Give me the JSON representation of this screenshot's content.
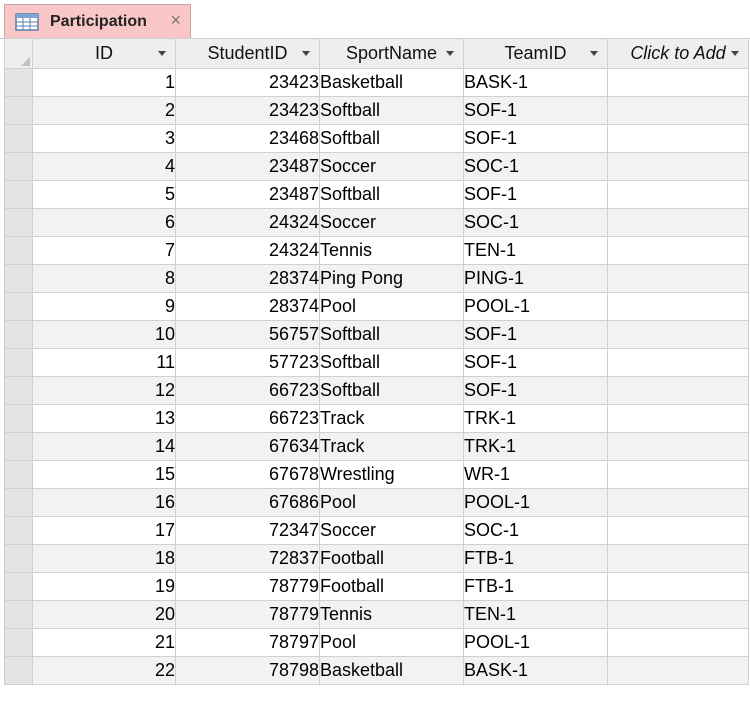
{
  "tab": {
    "label": "Participation",
    "close_symbol": "×",
    "icon": "table-icon"
  },
  "columns": [
    {
      "key": "id",
      "label": "ID"
    },
    {
      "key": "student",
      "label": "StudentID"
    },
    {
      "key": "sport",
      "label": "SportName"
    },
    {
      "key": "team",
      "label": "TeamID"
    },
    {
      "key": "add",
      "label": "Click to Add"
    }
  ],
  "rows": [
    {
      "id": "1",
      "student": "23423",
      "sport": "Basketball",
      "team": "BASK-1"
    },
    {
      "id": "2",
      "student": "23423",
      "sport": "Softball",
      "team": "SOF-1"
    },
    {
      "id": "3",
      "student": "23468",
      "sport": "Softball",
      "team": "SOF-1"
    },
    {
      "id": "4",
      "student": "23487",
      "sport": "Soccer",
      "team": "SOC-1"
    },
    {
      "id": "5",
      "student": "23487",
      "sport": "Softball",
      "team": "SOF-1"
    },
    {
      "id": "6",
      "student": "24324",
      "sport": "Soccer",
      "team": "SOC-1"
    },
    {
      "id": "7",
      "student": "24324",
      "sport": "Tennis",
      "team": "TEN-1"
    },
    {
      "id": "8",
      "student": "28374",
      "sport": "Ping Pong",
      "team": "PING-1"
    },
    {
      "id": "9",
      "student": "28374",
      "sport": "Pool",
      "team": "POOL-1"
    },
    {
      "id": "10",
      "student": "56757",
      "sport": "Softball",
      "team": "SOF-1"
    },
    {
      "id": "11",
      "student": "57723",
      "sport": "Softball",
      "team": "SOF-1"
    },
    {
      "id": "12",
      "student": "66723",
      "sport": "Softball",
      "team": "SOF-1"
    },
    {
      "id": "13",
      "student": "66723",
      "sport": "Track",
      "team": "TRK-1"
    },
    {
      "id": "14",
      "student": "67634",
      "sport": "Track",
      "team": "TRK-1"
    },
    {
      "id": "15",
      "student": "67678",
      "sport": "Wrestling",
      "team": "WR-1"
    },
    {
      "id": "16",
      "student": "67686",
      "sport": "Pool",
      "team": "POOL-1"
    },
    {
      "id": "17",
      "student": "72347",
      "sport": "Soccer",
      "team": "SOC-1"
    },
    {
      "id": "18",
      "student": "72837",
      "sport": "Football",
      "team": "FTB-1"
    },
    {
      "id": "19",
      "student": "78779",
      "sport": "Football",
      "team": "FTB-1"
    },
    {
      "id": "20",
      "student": "78779",
      "sport": "Tennis",
      "team": "TEN-1"
    },
    {
      "id": "21",
      "student": "78797",
      "sport": "Pool",
      "team": "POOL-1"
    },
    {
      "id": "22",
      "student": "78798",
      "sport": "Basketball",
      "team": "BASK-1"
    }
  ],
  "colors": {
    "tab_background": "#f9c7c7",
    "id_header_highlight": "#fbd955",
    "header_background": "#eeeeee",
    "alternate_row": "#f2f2f2"
  }
}
